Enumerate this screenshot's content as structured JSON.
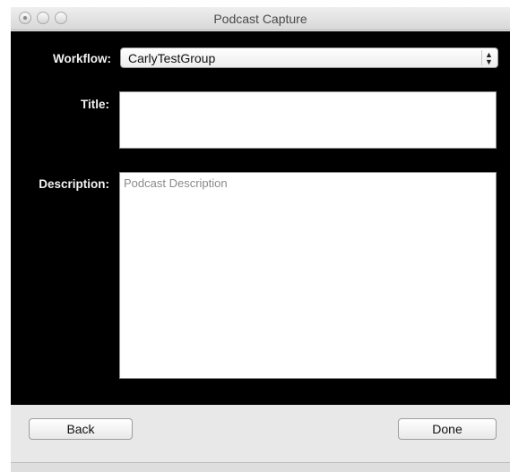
{
  "window": {
    "title": "Podcast Capture"
  },
  "form": {
    "workflow_label": "Workflow:",
    "workflow_value": "CarlyTestGroup",
    "title_label": "Title:",
    "title_value": "",
    "description_label": "Description:",
    "description_placeholder": "Podcast Description"
  },
  "footer": {
    "back_label": "Back",
    "done_label": "Done"
  },
  "colors": {
    "content_background": "#000000",
    "chrome_background": "#e8e8e8"
  }
}
